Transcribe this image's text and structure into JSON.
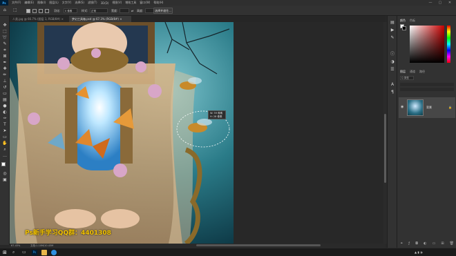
{
  "menubar": {
    "logo": "Ps",
    "items": [
      "文件(F)",
      "编辑(E)",
      "图像(I)",
      "图层(L)",
      "文字(Y)",
      "选择(S)",
      "滤镜(T)",
      "3D(D)",
      "视图(V)",
      "增效工具",
      "窗口(W)",
      "帮助(H)"
    ],
    "window_controls": [
      "—",
      "▢",
      "✕"
    ]
  },
  "optionsbar": {
    "feather_label": "羽化:",
    "feather_value": "0 像素",
    "style_label": "样式:",
    "style_value": "正常",
    "width_label": "宽度:",
    "height_label": "高度:",
    "select_mask_button": "选择并遮住..."
  },
  "tabs": [
    {
      "label": "人类.jpg @ 66.7% (图层 1, RGB/8#) ×",
      "active": false
    },
    {
      "label": "梦幻工具箱.psd @ 67.3% (RGB/8#) ×",
      "active": true
    }
  ],
  "tooltip": {
    "line1": "W: 59 像素",
    "line2": "H: 28 像素"
  },
  "watermark": "Ps新手学习QQ群：4401308",
  "statusbar": {
    "zoom": "67.43%",
    "doc_info": "文档:1.10M/10.43M"
  },
  "right_panel": {
    "color_tabs": [
      "颜色",
      "色板"
    ],
    "adjust_tabs": [
      "图层",
      "通道",
      "路径"
    ],
    "layer_filter_label": "Q 类型",
    "layer_name": "背景",
    "colors": {
      "fg": "#ffffff",
      "bg": "#000000",
      "picker_hue": "#c90000"
    }
  },
  "taskbar": {
    "time": "",
    "icons": [
      "windows-start-icon",
      "search-icon",
      "task-view-icon",
      "photoshop-icon",
      "folder-icon",
      "browser-icon"
    ]
  }
}
